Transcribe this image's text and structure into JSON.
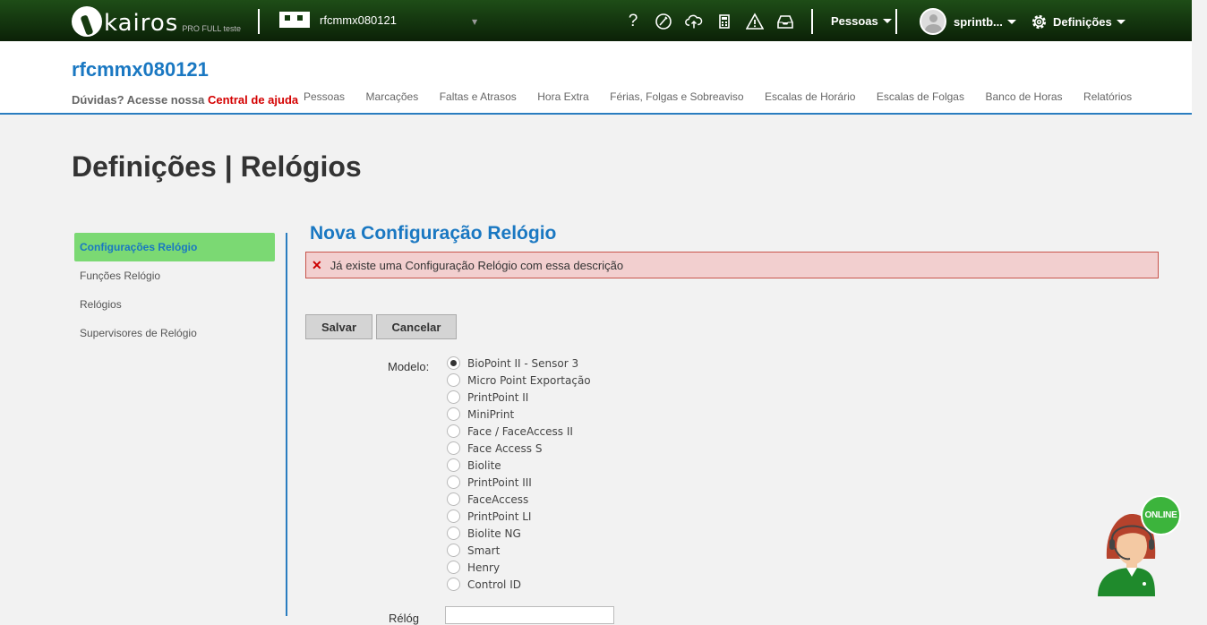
{
  "topbar": {
    "logo_text": "kairos",
    "logo_sub": "PRO FULL teste",
    "company_selector": "rfcmmx080121",
    "icons": [
      "help-icon",
      "wizard-icon",
      "cloud-upload-icon",
      "calculator-icon",
      "warning-icon",
      "inbox-icon"
    ],
    "help_glyph": "?",
    "pessoas_label": "Pessoas",
    "user_label": "sprintb...",
    "settings_label": "Definições"
  },
  "header": {
    "company_title": "rfcmmx080121",
    "help_prefix": "Dúvidas? Acesse nossa ",
    "help_link": "Central de ajuda",
    "nav": [
      "Pessoas",
      "Marcações",
      "Faltas e Atrasos",
      "Hora Extra",
      "Férias, Folgas e Sobreaviso",
      "Escalas de Horário",
      "Escalas de Folgas",
      "Banco de Horas",
      "Relatórios"
    ]
  },
  "page": {
    "title": "Definições | Relógios"
  },
  "sidebar": {
    "items": [
      {
        "label": "Configurações Relógio",
        "active": true
      },
      {
        "label": "Funções Relógio",
        "active": false
      },
      {
        "label": "Relógios",
        "active": false
      },
      {
        "label": "Supervisores de Relógio",
        "active": false
      }
    ]
  },
  "form": {
    "title": "Nova Configuração Relógio",
    "error": "Já existe uma Configuração Relógio com essa descrição",
    "save_label": "Salvar",
    "cancel_label": "Cancelar",
    "modelo_label": "Modelo:",
    "next_label": "Rélóg",
    "selected_model": "BioPoint II - Sensor 3",
    "models": [
      "BioPoint II - Sensor 3",
      "Micro Point Exportação",
      "PrintPoint II",
      "MiniPrint",
      "Face / FaceAccess II",
      "Face Access S",
      "Biolite",
      "PrintPoint III",
      "FaceAccess",
      "PrintPoint LI",
      "Biolite NG",
      "Smart",
      "Henry",
      "Control ID"
    ]
  },
  "chat": {
    "status": "ONLINE"
  },
  "colors": {
    "accent": "#1a78c2",
    "active_nav": "#7bd973",
    "error_bg": "#f2cfcf",
    "help_link": "#d40000",
    "topbar": "#0b2107"
  }
}
